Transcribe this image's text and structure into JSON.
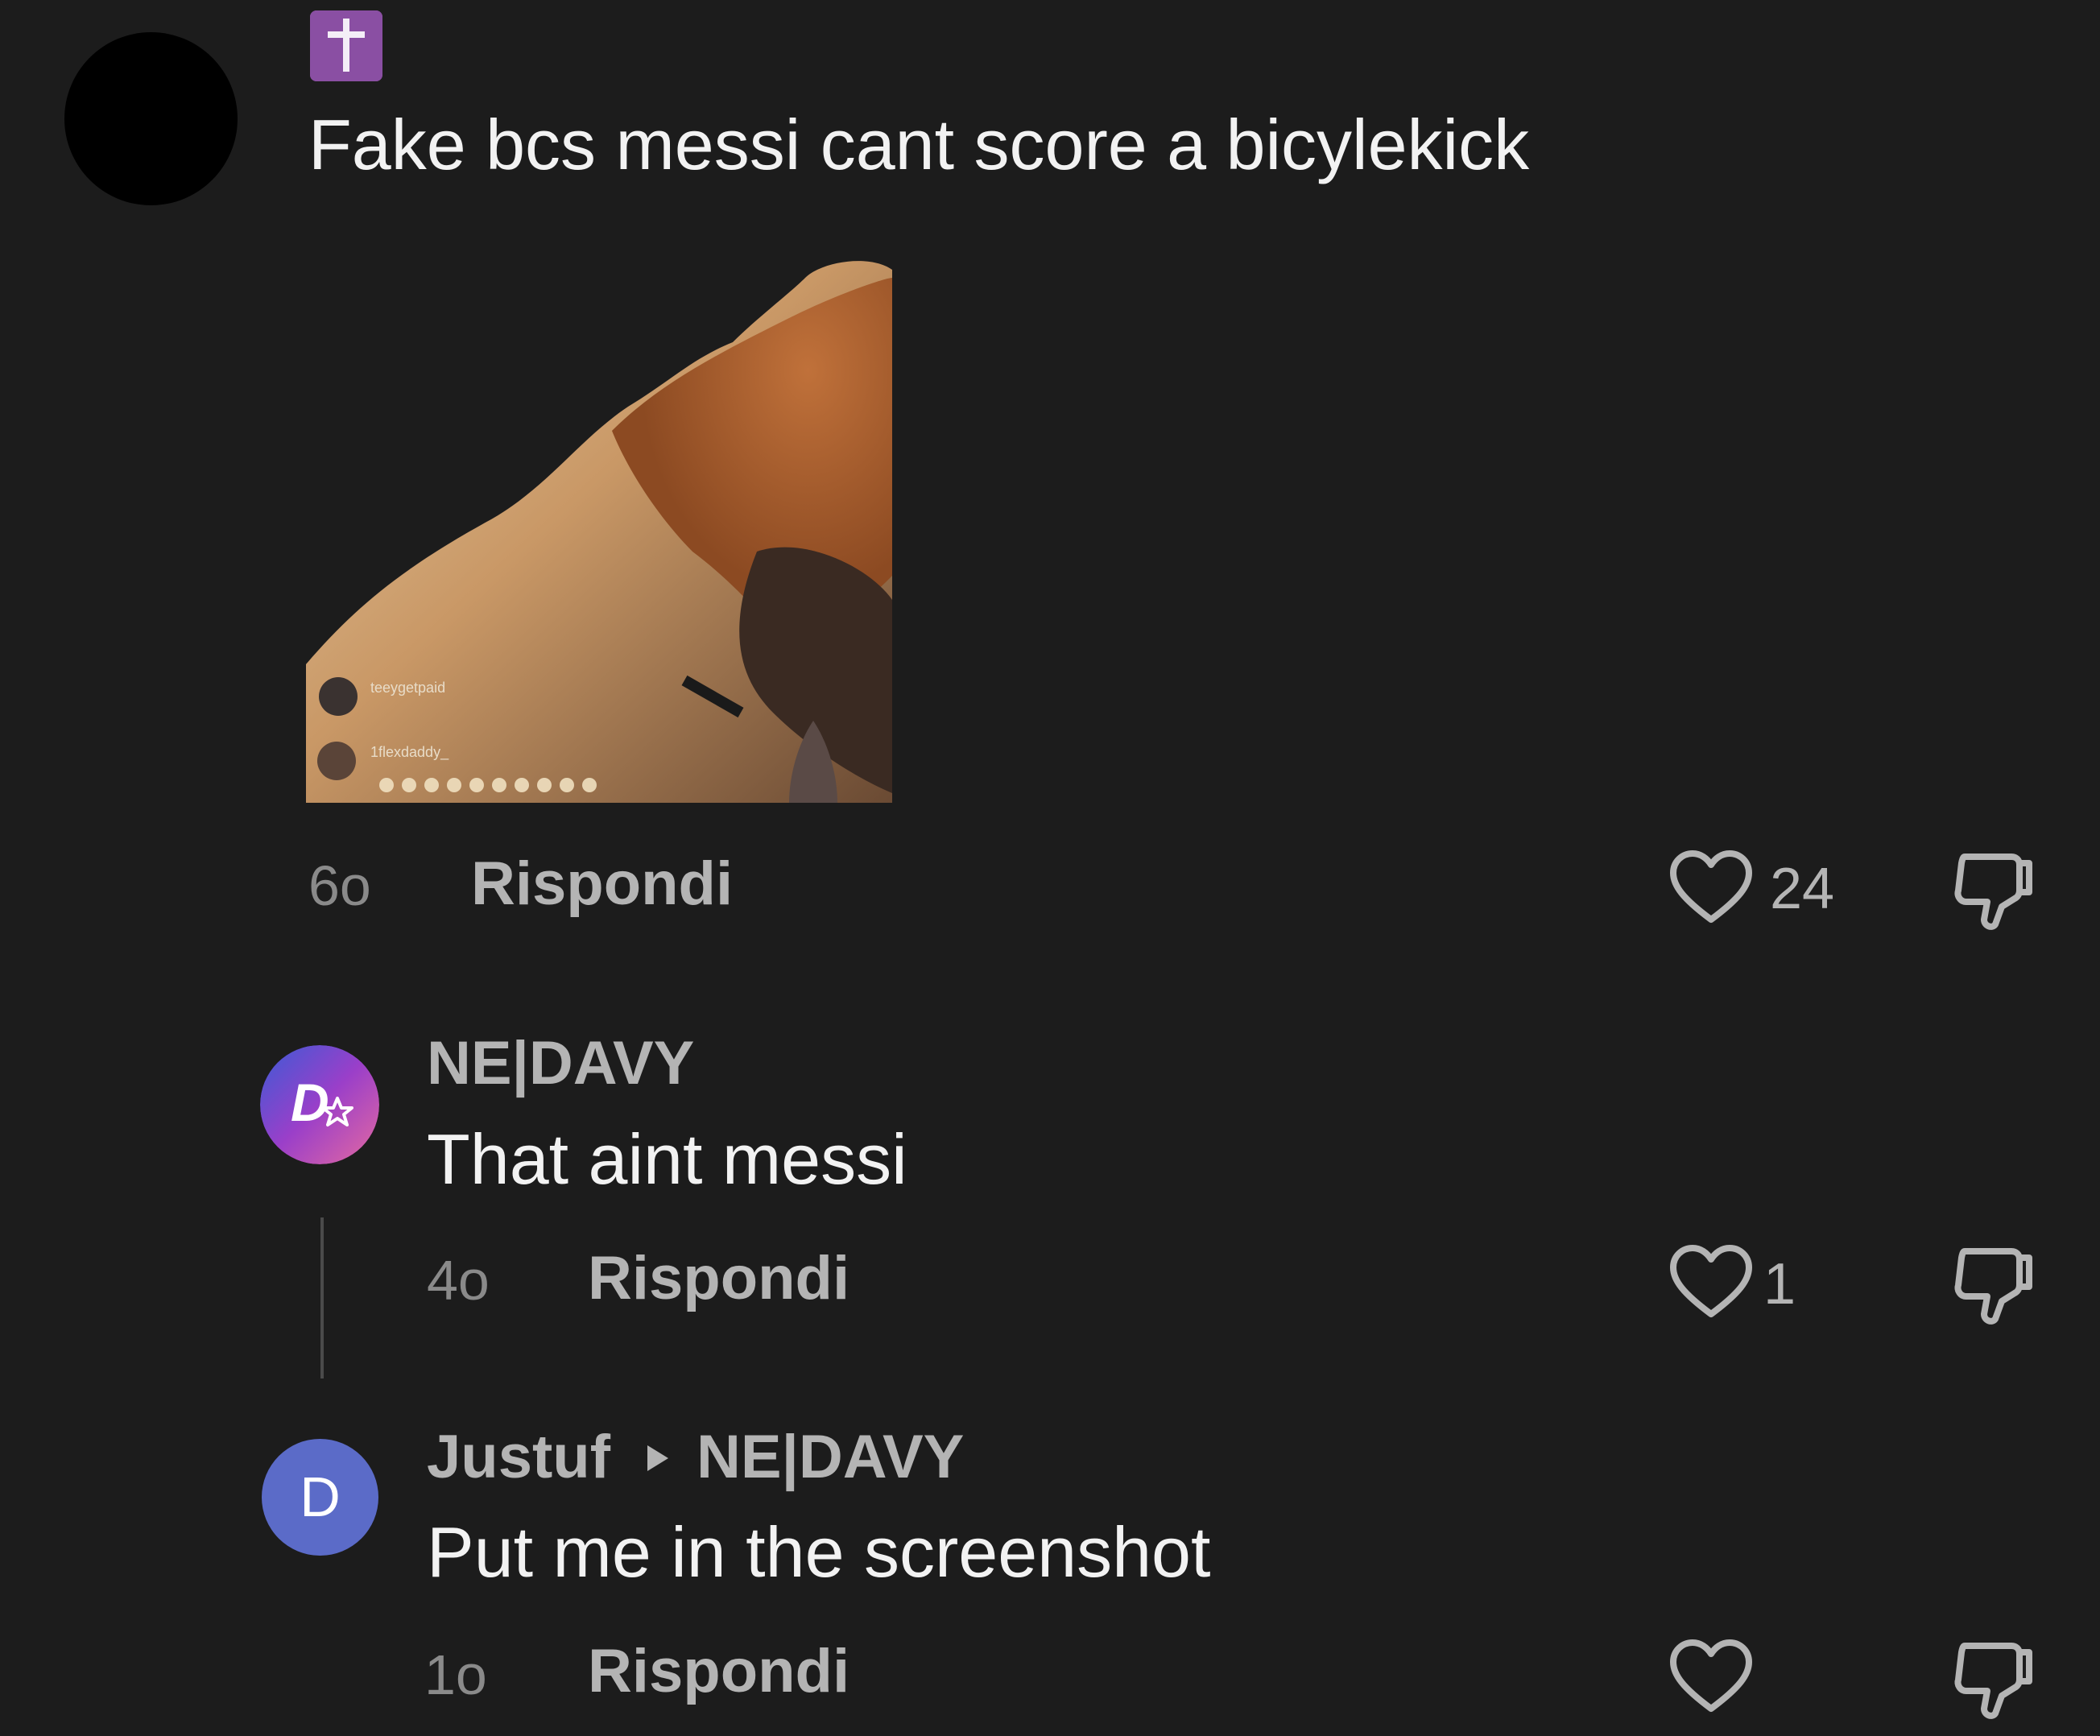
{
  "comments": [
    {
      "badge_icon": "latin-cross-icon",
      "badge_color": "#8a4fa3",
      "text": "Fake bcs messi cant score a bicylekick",
      "has_gif": true,
      "time": "6o",
      "reply_label": "Rispondi",
      "likes": "24"
    },
    {
      "avatar_icon": "star-d-avatar",
      "username": "NE|DAVY",
      "text": "That aint messi",
      "time": "4o",
      "reply_label": "Rispondi",
      "likes": "1"
    },
    {
      "avatar_letter": "D",
      "avatar_color": "#5b6bc8",
      "username": "Justuf",
      "reply_to": "NE|DAVY",
      "text": "Put me in the screenshot",
      "time": "1o",
      "reply_label": "Rispondi",
      "likes": ""
    }
  ],
  "gif_overlay": {
    "line1": "teeygetpaid",
    "line2": "1flexdaddy_"
  }
}
